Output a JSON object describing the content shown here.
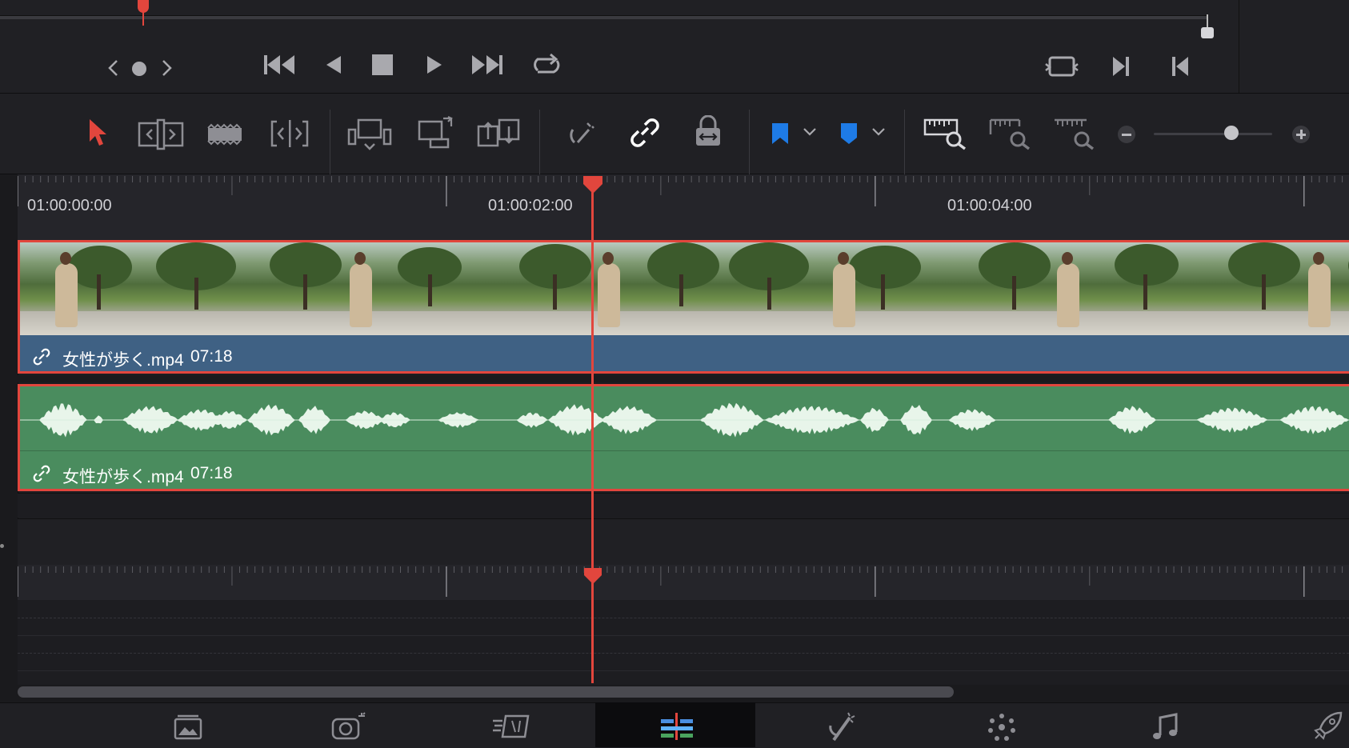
{
  "timeline": {
    "ruler_timecodes": [
      "01:00:00:00",
      "01:00:02:00",
      "01:00:04:00"
    ]
  },
  "video_track": {
    "clip_name": "女性が歩く.mp4",
    "clip_duration": "07:18"
  },
  "audio_track": {
    "clip_name": "女性が歩く.mp4",
    "clip_duration": "07:18"
  },
  "colors": {
    "playhead": "#e2463d",
    "selection_border": "#e2463d",
    "video_clip": "#3f6184",
    "audio_clip": "#4a8c5e",
    "flag_marker": "#1e7be6"
  },
  "transport": {
    "buttons": [
      "prev-clip-icon",
      "dot-icon",
      "next-clip-icon",
      "jump-start-icon",
      "reverse-play-icon",
      "stop-icon",
      "play-icon",
      "jump-end-icon",
      "loop-icon",
      "match-frame-icon",
      "next-edit-icon",
      "prev-edit-icon"
    ]
  },
  "toolbar": {
    "tools": [
      "selection-tool-icon",
      "trim-edit-icon",
      "blade-icon",
      "dynamic-trim-icon",
      "insert-clip-icon",
      "overwrite-clip-icon",
      "replace-clip-icon",
      "snapping-icon",
      "linked-selection-icon",
      "position-lock-icon",
      "flag-icon",
      "marker-icon",
      "full-zoom-icon",
      "detail-zoom-icon",
      "custom-zoom-icon",
      "zoom-out-icon",
      "zoom-in-icon"
    ],
    "zoom_level": 0.7
  },
  "page_nav": [
    "media-page-icon",
    "cut-page-icon",
    "edit-page-icon",
    "fusion-page-icon",
    "color-page-icon",
    "fairlight-page-icon",
    "deliver-page-icon"
  ],
  "playhead_position": 0.42
}
